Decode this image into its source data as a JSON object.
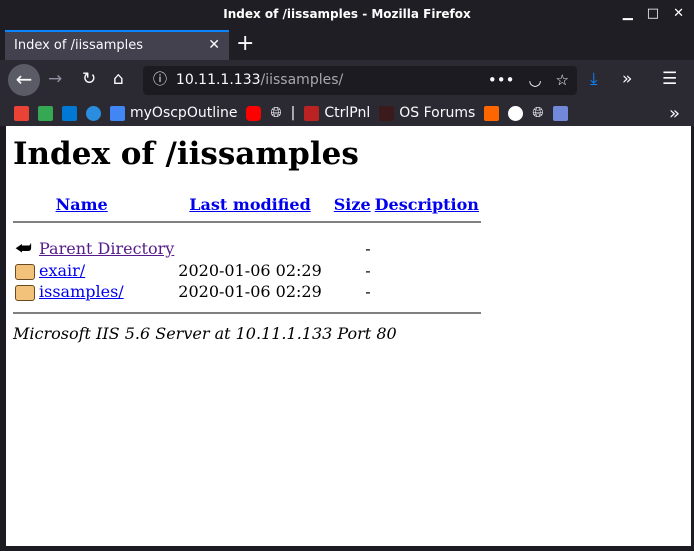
{
  "window": {
    "title": "Index of /iissamples - Mozilla Firefox"
  },
  "tab": {
    "title": "Index of /iissamples"
  },
  "url": {
    "host": "10.11.1.133",
    "path": "/iissamples/"
  },
  "bookmarks": [
    {
      "label": "",
      "icon": "gmail-icon"
    },
    {
      "label": "",
      "icon": "drive-icon"
    },
    {
      "label": "",
      "icon": "outlook-icon"
    },
    {
      "label": "",
      "icon": "onedrive-icon"
    },
    {
      "label": "myOscpOutline",
      "icon": "docs-icon"
    },
    {
      "label": "",
      "icon": "youtube-icon"
    },
    {
      "label": "",
      "icon": "globe-icon"
    },
    {
      "label": "CtrlPnl",
      "icon": "ctrlpnl-icon"
    },
    {
      "label": "OS Forums",
      "icon": "forums-icon"
    },
    {
      "label": "",
      "icon": "bolt-icon"
    },
    {
      "label": "",
      "icon": "github-icon"
    },
    {
      "label": "",
      "icon": "globe-icon"
    },
    {
      "label": "",
      "icon": "discord-icon"
    }
  ],
  "page": {
    "heading": "Index of /iissamples",
    "columns": {
      "name": "Name",
      "modified": "Last modified",
      "size": "Size",
      "description": "Description"
    },
    "rows": [
      {
        "name": "Parent Directory",
        "modified": "",
        "size": "-",
        "icon": "back-icon"
      },
      {
        "name": "exair/",
        "modified": "2020-01-06 02:29",
        "size": "-",
        "icon": "folder-icon"
      },
      {
        "name": "issamples/",
        "modified": "2020-01-06 02:29",
        "size": "-",
        "icon": "folder-icon"
      }
    ],
    "footer": "Microsoft IIS 5.6 Server at 10.11.1.133 Port 80"
  }
}
